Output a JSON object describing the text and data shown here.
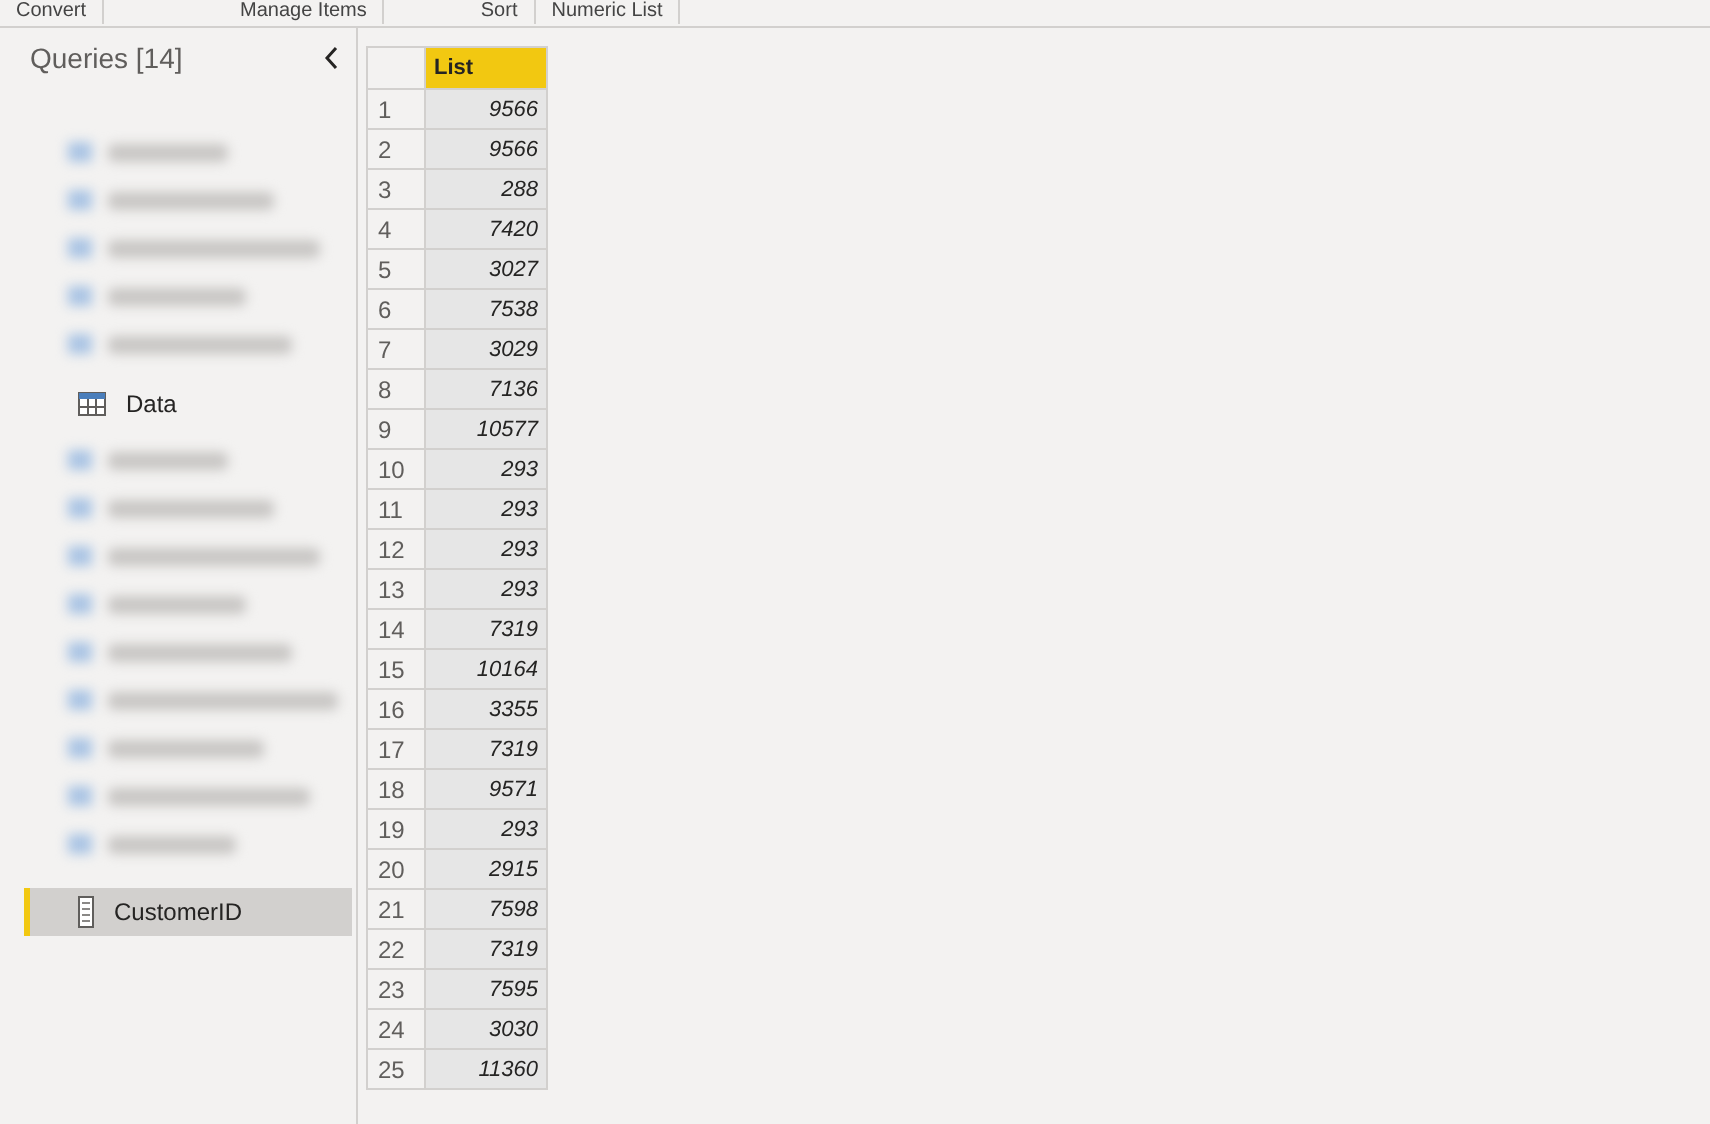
{
  "ribbon_groups": [
    {
      "label": "Convert"
    },
    {
      "label": "Manage Items"
    },
    {
      "label": "Sort"
    },
    {
      "label": "Numeric List"
    }
  ],
  "queries_pane": {
    "title": "Queries [14]",
    "items": [
      {
        "kind": "redacted"
      },
      {
        "kind": "table",
        "label": "Data",
        "selected": false
      },
      {
        "kind": "redacted"
      },
      {
        "kind": "list",
        "label": "CustomerID",
        "selected": true
      }
    ]
  },
  "table": {
    "columns": [
      "List"
    ],
    "rows": [
      {
        "index": "1",
        "value": "9566"
      },
      {
        "index": "2",
        "value": "9566"
      },
      {
        "index": "3",
        "value": "288"
      },
      {
        "index": "4",
        "value": "7420"
      },
      {
        "index": "5",
        "value": "3027"
      },
      {
        "index": "6",
        "value": "7538"
      },
      {
        "index": "7",
        "value": "3029"
      },
      {
        "index": "8",
        "value": "7136"
      },
      {
        "index": "9",
        "value": "10577"
      },
      {
        "index": "10",
        "value": "293"
      },
      {
        "index": "11",
        "value": "293"
      },
      {
        "index": "12",
        "value": "293"
      },
      {
        "index": "13",
        "value": "293"
      },
      {
        "index": "14",
        "value": "7319"
      },
      {
        "index": "15",
        "value": "10164"
      },
      {
        "index": "16",
        "value": "3355"
      },
      {
        "index": "17",
        "value": "7319"
      },
      {
        "index": "18",
        "value": "9571"
      },
      {
        "index": "19",
        "value": "293"
      },
      {
        "index": "20",
        "value": "2915"
      },
      {
        "index": "21",
        "value": "7598"
      },
      {
        "index": "22",
        "value": "7319"
      },
      {
        "index": "23",
        "value": "7595"
      },
      {
        "index": "24",
        "value": "3030"
      },
      {
        "index": "25",
        "value": "11360"
      }
    ]
  }
}
